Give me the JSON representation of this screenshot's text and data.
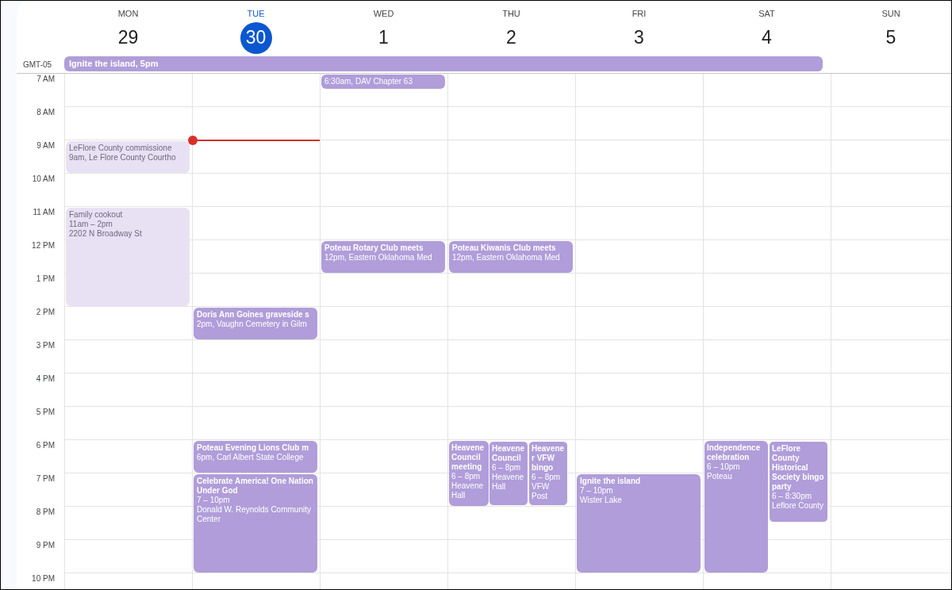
{
  "timezone": "GMT-05",
  "all_day_events": [
    {
      "title": "Ignite the island, 5pm",
      "past": false
    }
  ],
  "hours": [
    "7 AM",
    "8 AM",
    "9 AM",
    "10 AM",
    "11 AM",
    "12 PM",
    "1 PM",
    "2 PM",
    "3 PM",
    "4 PM",
    "5 PM",
    "6 PM",
    "7 PM",
    "8 PM",
    "9 PM",
    "10 PM"
  ],
  "days": [
    {
      "label": "MON",
      "date": "29",
      "selected": false,
      "current_time_marker": false,
      "events": [
        {
          "title": "LeFlore County commissione",
          "details": [
            "9am, Le Flore County Courtho"
          ],
          "past": true
        },
        {
          "title": "Family cookout",
          "details": [
            "11am – 2pm",
            "2202 N Broadway St"
          ],
          "past": true
        }
      ]
    },
    {
      "label": "TUE",
      "date": "30",
      "selected": true,
      "current_time_marker": true,
      "events": [
        {
          "title": "Doris Ann Goines graveside s",
          "details": [
            "2pm, Vaughn Cemetery in Gilm"
          ],
          "past": false
        },
        {
          "title": "Poteau Evening Lions Club m",
          "details": [
            "6pm, Carl Albert State College"
          ],
          "past": false
        },
        {
          "title": "Celebrate America! One Nation Under God",
          "details": [
            "7 – 10pm",
            "Donald W. Reynolds Community Center"
          ],
          "past": false
        }
      ]
    },
    {
      "label": "WED",
      "date": "1",
      "selected": false,
      "current_time_marker": false,
      "events": [
        {
          "details": [
            "6:30am, DAV Chapter 63"
          ],
          "past": false
        },
        {
          "title": "Poteau Rotary Club meets",
          "details": [
            "12pm, Eastern Oklahoma Med"
          ],
          "past": false
        }
      ]
    },
    {
      "label": "THU",
      "date": "2",
      "selected": false,
      "current_time_marker": false,
      "events": [
        {
          "title": "Poteau Kiwanis Club meets",
          "details": [
            "12pm, Eastern Oklahoma Med"
          ],
          "past": false
        },
        {
          "title": "Heavene Council meeting",
          "details": [
            "6 – 8pm",
            "Heavene Hall"
          ],
          "past": false
        },
        {
          "title": "Heavene Council",
          "details": [
            "6 – 8pm",
            "Heavene Hall"
          ],
          "past": false
        },
        {
          "title": "Heavener VFW bingo",
          "details": [
            "6 – 8pm",
            "VFW Post"
          ],
          "past": false
        }
      ]
    },
    {
      "label": "FRI",
      "date": "3",
      "selected": false,
      "current_time_marker": false,
      "events": [
        {
          "title": "Ignite the island",
          "details": [
            "7 – 10pm",
            "Wister Lake"
          ],
          "past": false
        }
      ]
    },
    {
      "label": "SAT",
      "date": "4",
      "selected": false,
      "current_time_marker": false,
      "events": [
        {
          "title": "Independence celebration",
          "details": [
            "6 – 10pm",
            "Poteau"
          ],
          "past": false
        },
        {
          "title": "LeFlore County Historical Society bingo party",
          "details": [
            "6 – 8:30pm",
            "Leflore County"
          ],
          "past": false
        }
      ]
    },
    {
      "label": "SUN",
      "date": "5",
      "selected": false,
      "current_time_marker": false
    }
  ]
}
